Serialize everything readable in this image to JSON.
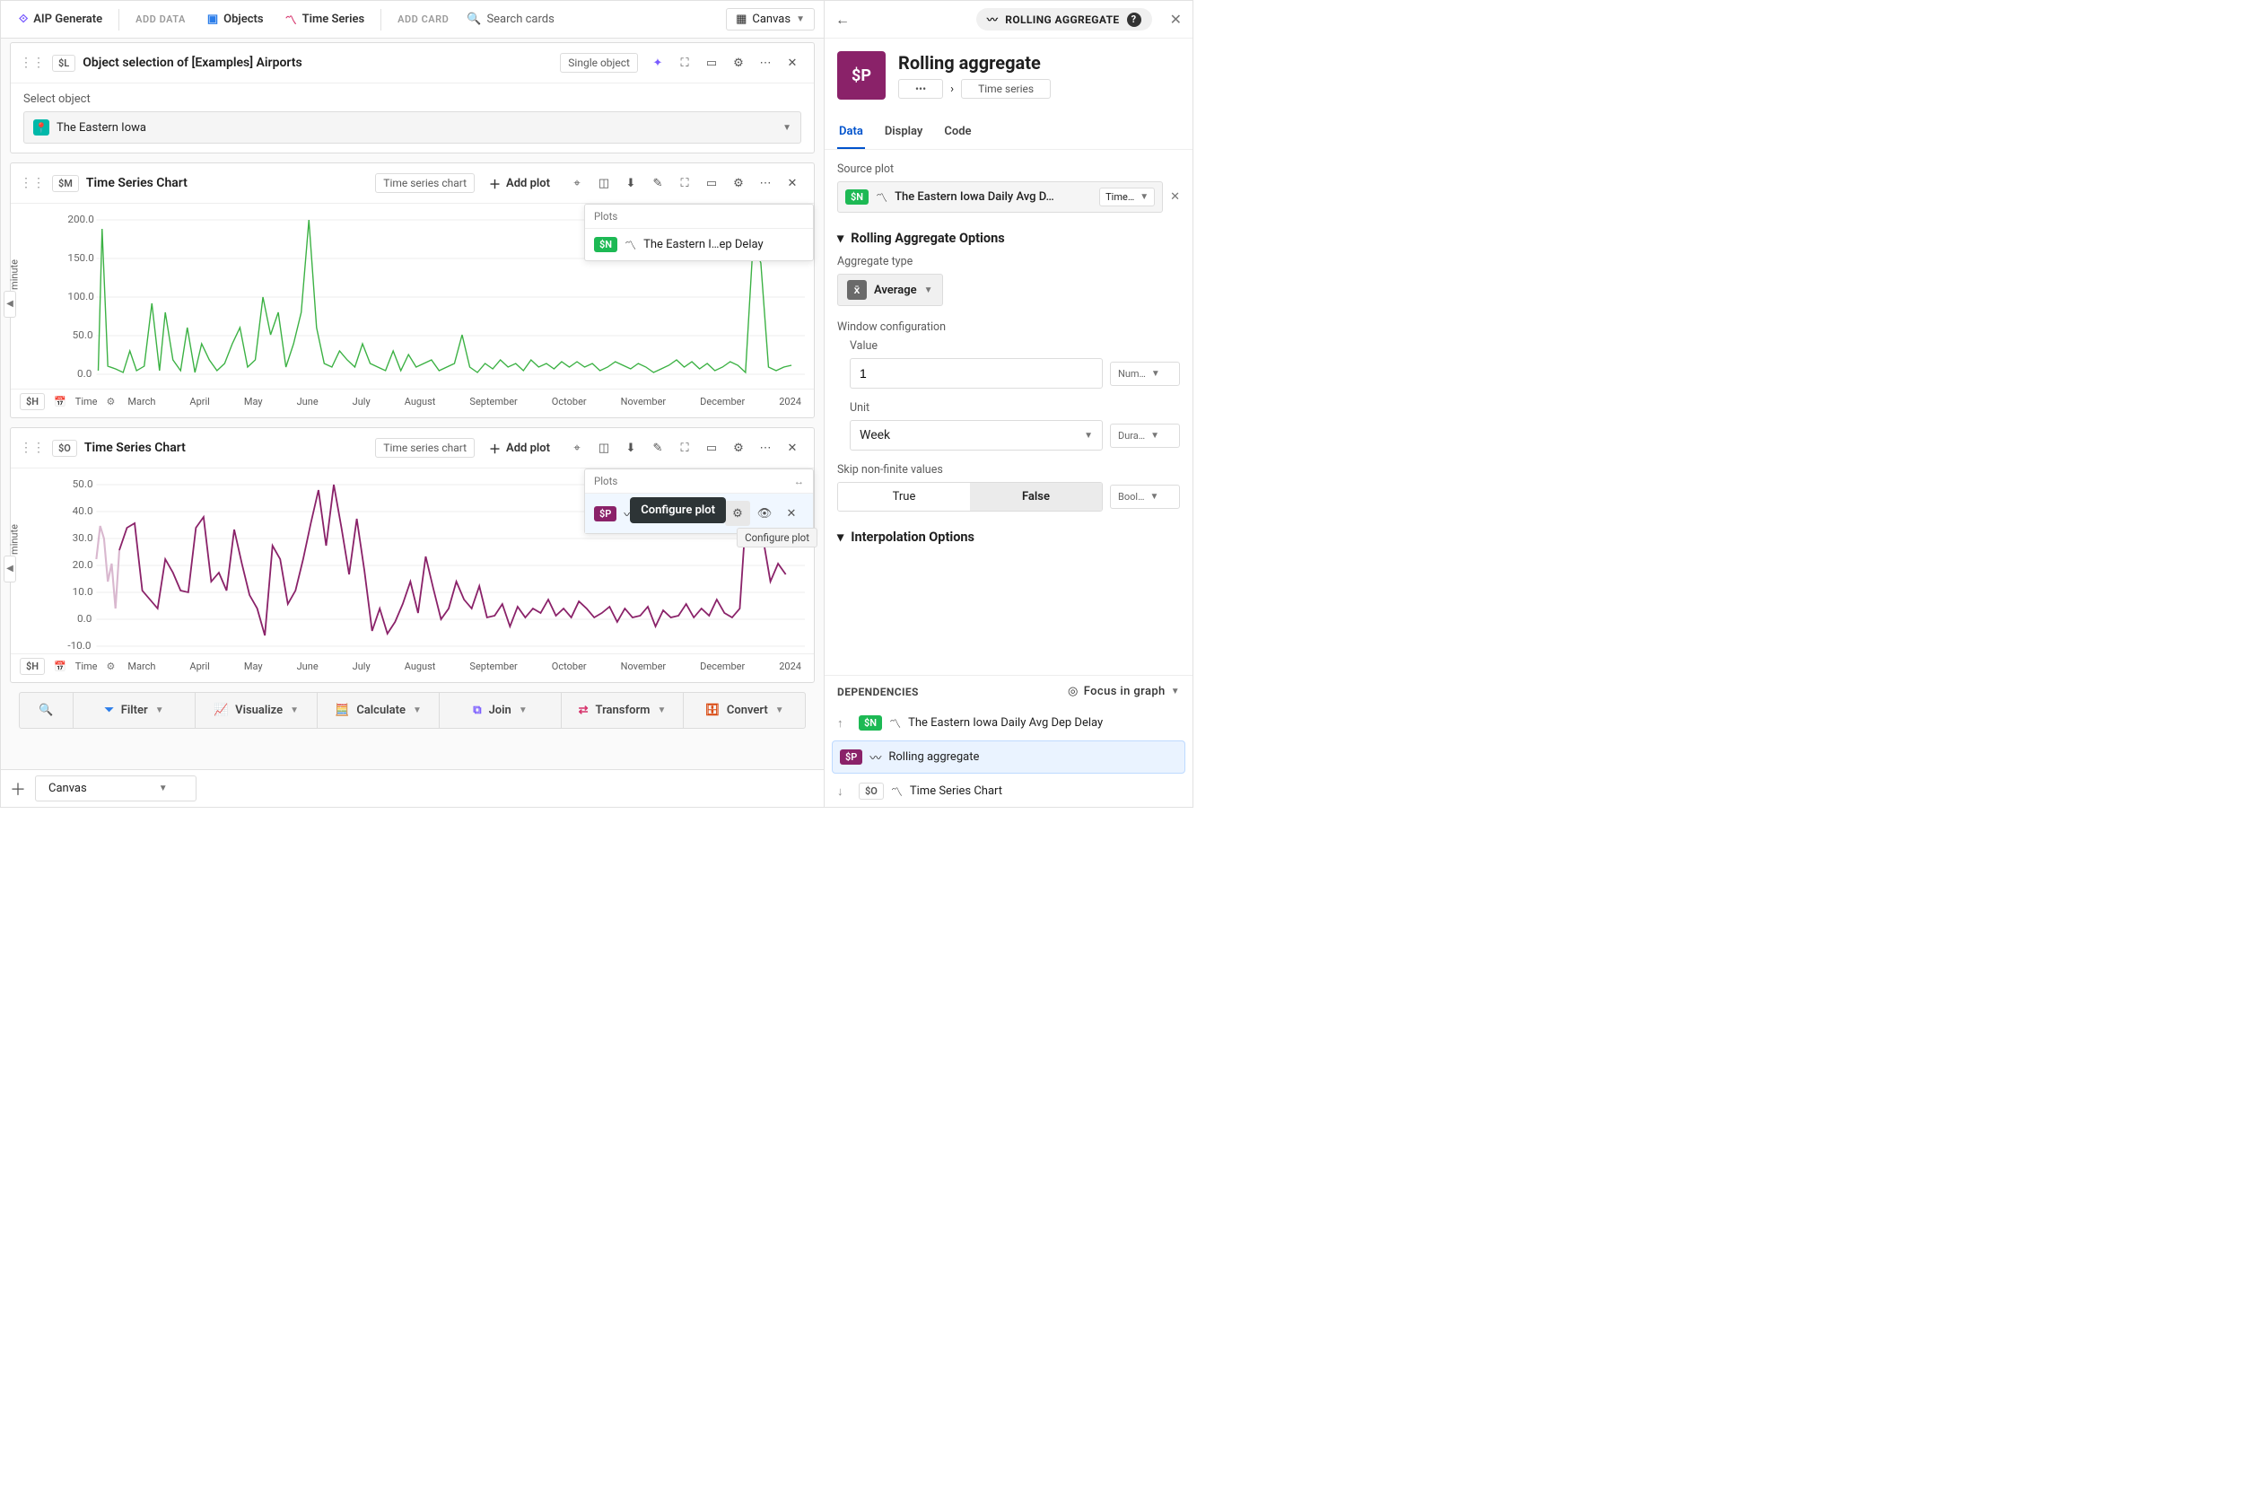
{
  "toolbar": {
    "aip_generate": "AIP Generate",
    "add_data": "ADD DATA",
    "objects": "Objects",
    "time_series": "Time Series",
    "add_card": "ADD CARD",
    "search_placeholder": "Search cards",
    "canvas": "Canvas"
  },
  "card_object": {
    "badge": "$L",
    "title": "Object selection of [Examples] Airports",
    "single": "Single object",
    "select_label": "Select object",
    "select_value": "The Eastern Iowa"
  },
  "card_chart1": {
    "badge": "$M",
    "title": "Time Series Chart",
    "chip": "Time series chart",
    "add_plot": "Add plot",
    "plots_label": "Plots",
    "plot_badge": "$N",
    "plot_name": "The Eastern I…ep Delay",
    "y_label": "minute",
    "time_label": "Time"
  },
  "card_chart2": {
    "badge": "$O",
    "title": "Time Series Chart",
    "chip": "Time series chart",
    "add_plot": "Add plot",
    "plots_label": "Plots",
    "plot_badge": "$P",
    "tooltip_dark": "Configure plot",
    "tooltip_light": "Configure plot",
    "y_label": "minute",
    "time_label": "Time"
  },
  "x_axis": {
    "badge": "$H",
    "months": [
      "March",
      "April",
      "May",
      "June",
      "July",
      "August",
      "September",
      "October",
      "November",
      "December",
      "2024"
    ]
  },
  "actionbar": {
    "filter": "Filter",
    "visualize": "Visualize",
    "calculate": "Calculate",
    "join": "Join",
    "transform": "Transform",
    "convert": "Convert"
  },
  "footer": {
    "canvas_tab": "Canvas"
  },
  "sidebar": {
    "pill": "ROLLING AGGREGATE",
    "title": "Rolling aggregate",
    "tile_text": "$P",
    "crumb1": "•••",
    "crumb2": "Time series",
    "crumb_sep": "›",
    "tabs": {
      "data": "Data",
      "display": "Display",
      "code": "Code"
    },
    "source_plot_label": "Source plot",
    "src_badge": "$N",
    "src_text": "The Eastern Iowa Daily Avg D…",
    "src_type": "Time…",
    "grp_rolling": "Rolling Aggregate Options",
    "agg_type_label": "Aggregate type",
    "agg_type_value": "Average",
    "win_label": "Window configuration",
    "value_label": "Value",
    "value_input": "1",
    "value_type": "Num…",
    "unit_label": "Unit",
    "unit_value": "Week",
    "unit_type": "Dura…",
    "skip_label": "Skip non-finite values",
    "skip_true": "True",
    "skip_false": "False",
    "skip_type": "Bool…",
    "grp_interp": "Interpolation Options",
    "deps_label": "DEPENDENCIES",
    "focus_label": "Focus in graph",
    "dep1": {
      "badge": "$N",
      "name": "The Eastern Iowa Daily Avg Dep Delay"
    },
    "dep2": {
      "badge": "$P",
      "name": "Rolling aggregate"
    },
    "dep3": {
      "badge": "$O",
      "name": "Time Series Chart"
    }
  },
  "chart_data": [
    {
      "type": "line",
      "title": "Time Series Chart ($M)",
      "series_name": "The Eastern Iowa Daily Avg Dep Delay",
      "xlabel": "Time",
      "ylabel": "minute",
      "ylim": [
        0,
        200
      ],
      "yticks": [
        0,
        50,
        100,
        150,
        200
      ],
      "x_categories": [
        "March",
        "April",
        "May",
        "June",
        "July",
        "August",
        "September",
        "October",
        "November",
        "December",
        "2024"
      ],
      "values_estimated": [
        5,
        180,
        10,
        8,
        5,
        30,
        5,
        10,
        90,
        5,
        80,
        20,
        5,
        60,
        5,
        40,
        20,
        5,
        15,
        40,
        60,
        10,
        20,
        100,
        50,
        80,
        10,
        40,
        80,
        200,
        60,
        15,
        10,
        30,
        20,
        10,
        40,
        15,
        10,
        5,
        30,
        5,
        25,
        10,
        15,
        20,
        170,
        140,
        10,
        5
      ]
    },
    {
      "type": "line",
      "title": "Time Series Chart ($O) — Rolling aggregate ($P)",
      "series_name": "Rolling aggregate (1 Week Average)",
      "xlabel": "Time",
      "ylabel": "minute",
      "ylim": [
        -10,
        50
      ],
      "yticks": [
        -10,
        0,
        10,
        20,
        30,
        40,
        50
      ],
      "x_categories": [
        "March",
        "April",
        "May",
        "June",
        "July",
        "August",
        "September",
        "October",
        "November",
        "December",
        "2024"
      ],
      "values_estimated": [
        30,
        35,
        10,
        8,
        5,
        25,
        38,
        12,
        18,
        10,
        33,
        14,
        5,
        -5,
        30,
        22,
        8,
        10,
        25,
        40,
        48,
        30,
        50,
        35,
        18,
        40,
        20,
        2,
        5,
        -5,
        0,
        8,
        12,
        5,
        22,
        10,
        0,
        6,
        14,
        8,
        5,
        12,
        2,
        38,
        30,
        12,
        5
      ]
    }
  ]
}
